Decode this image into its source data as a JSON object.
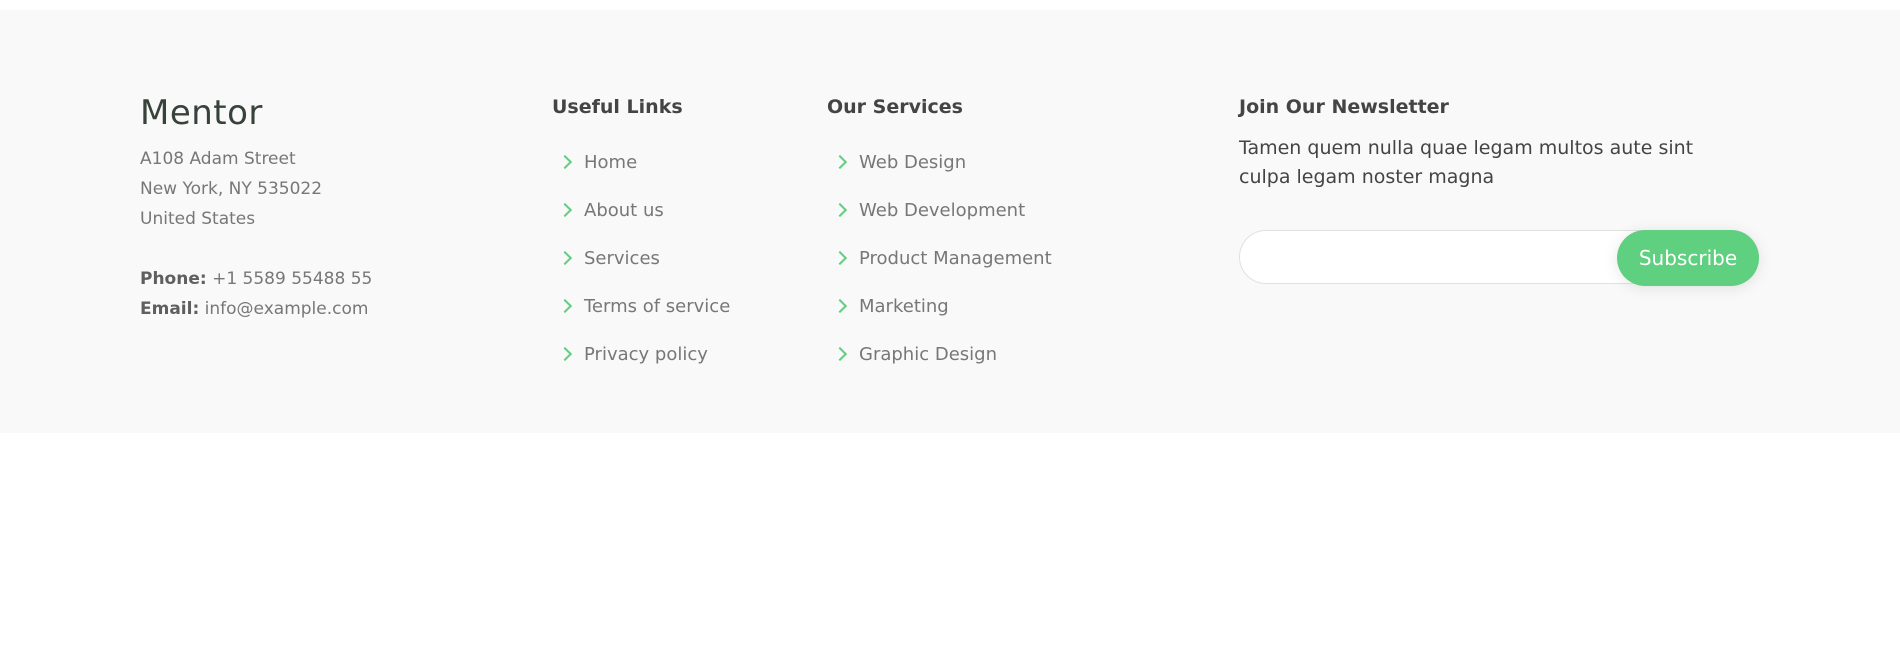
{
  "contact": {
    "brand": "Mentor",
    "address_line1": "A108 Adam Street",
    "address_line2": "New York, NY 535022",
    "address_line3": "United States",
    "phone_label": "Phone:",
    "phone_value": "+1 5589 55488 55",
    "email_label": "Email:",
    "email_value": "info@example.com"
  },
  "useful_links": {
    "title": "Useful Links",
    "items": [
      "Home",
      "About us",
      "Services",
      "Terms of service",
      "Privacy policy"
    ]
  },
  "services": {
    "title": "Our Services",
    "items": [
      "Web Design",
      "Web Development",
      "Product Management",
      "Marketing",
      "Graphic Design"
    ]
  },
  "newsletter": {
    "title": "Join Our Newsletter",
    "description": "Tamen quem nulla quae legam multos aute sint culpa legam noster magna",
    "input_placeholder": "",
    "button_label": "Subscribe"
  },
  "colors": {
    "accent": "#5fcf80",
    "footer_background": "#f9f9f9",
    "heading_text": "#444444",
    "body_text": "#777777"
  },
  "icons": {
    "list_bullet": "chevron-right-icon"
  }
}
